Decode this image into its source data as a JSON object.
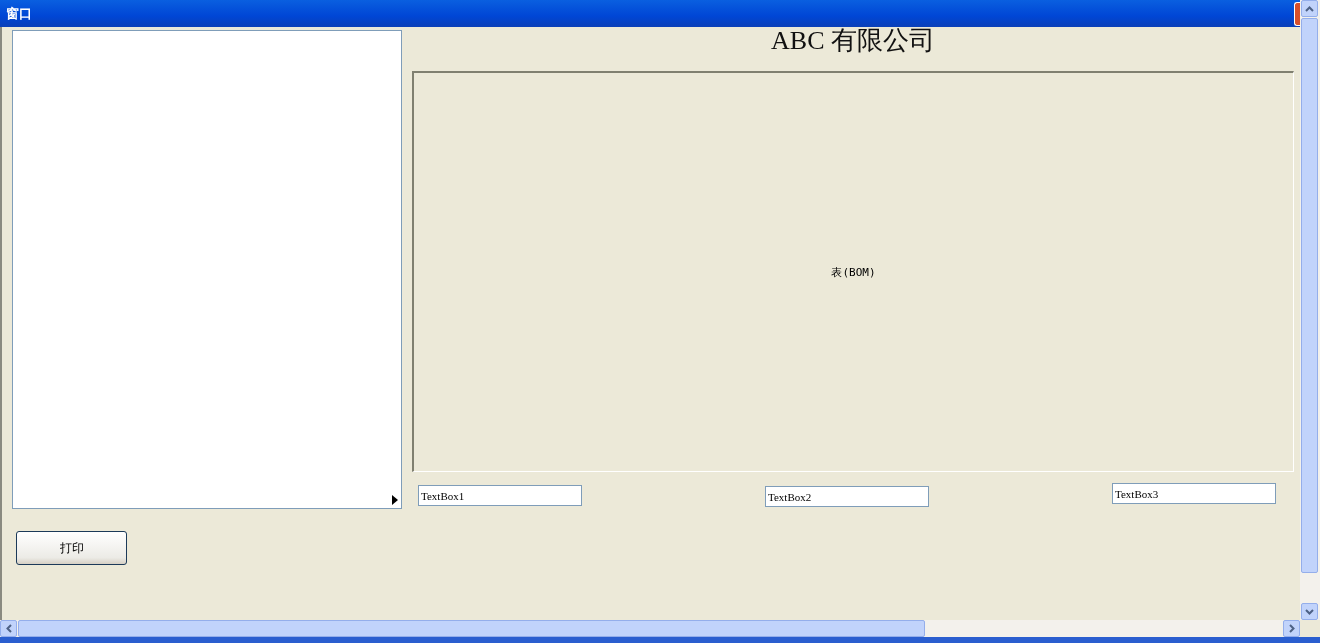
{
  "window": {
    "title": "窗口"
  },
  "company_title": "ABC 有限公司",
  "table": {
    "caption": "表(BOM)"
  },
  "text_boxes": [
    {
      "value": "TextBox1"
    },
    {
      "value": "TextBox2"
    },
    {
      "value": "TextBox3"
    }
  ],
  "print_button": {
    "label": "打印"
  }
}
